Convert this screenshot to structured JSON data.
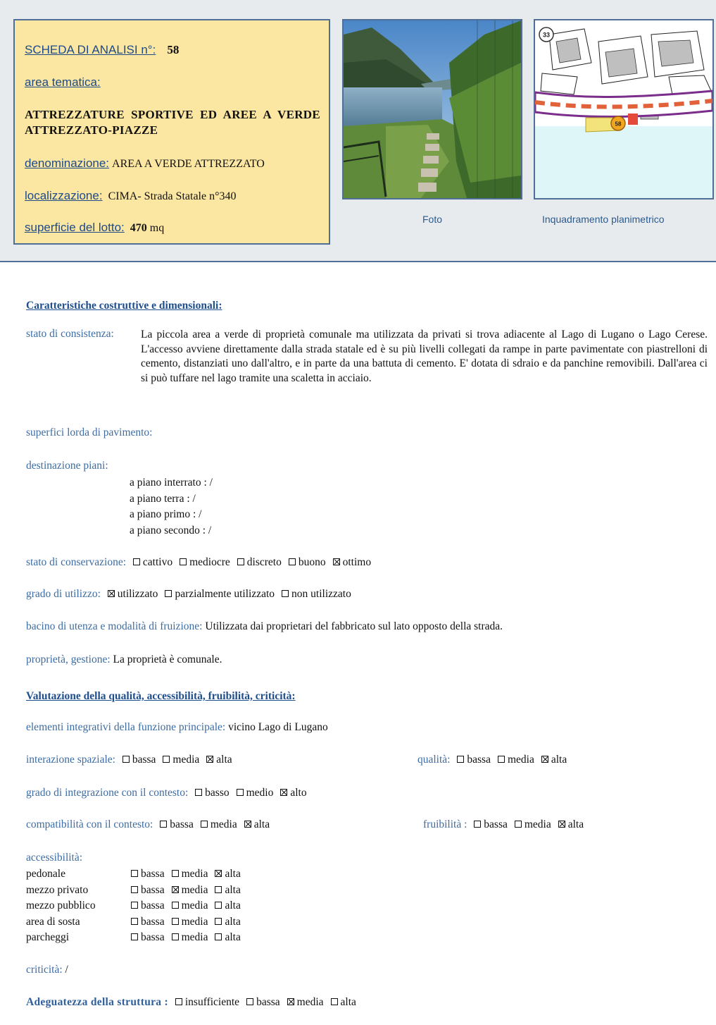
{
  "header": {
    "scheda_label": "SCHEDA DI ANALISI n°:",
    "scheda_number": "58",
    "area_label": "area tematica:",
    "area_value": "ATTREZZATURE SPORTIVE ED AREE A VERDE ATTREZZATO-PIAZZE",
    "denominazione_label": "denominazione:",
    "denominazione_value": "AREA A VERDE ATTREZZATO",
    "localizzazione_label": "localizzazione:",
    "localizzazione_value": "CIMA- Strada Statale n°340",
    "superficie_label": "superficie del lotto:",
    "superficie_value": "470",
    "superficie_unit": "mq",
    "photo_caption": "Foto",
    "map_caption": "Inquadramento planimetrico",
    "map_badge_top": "33",
    "map_badge_site": "58"
  },
  "body": {
    "section1_title": "Caratteristiche costruttive e dimensionali:",
    "stato_consistenza_label": "stato di consistenza:",
    "stato_consistenza_text": "La piccola area a verde di proprietà comunale ma utilizzata da privati si trova adiacente al Lago di Lugano o Lago Cerese. L'accesso avviene direttamente dalla strada statale ed è su più livelli collegati da rampe in parte pavimentate con piastrelloni di cemento, distanziati uno dall'altro, e in parte da una battuta di cemento. E' dotata di sdraio e da panchine removibili. Dall'area ci si può tuffare nel lago tramite una scaletta in acciaio.",
    "superfici_label": "superfici lorda di pavimento:",
    "destinazione_label": "destinazione piani:",
    "piani": [
      "a piano interrato : /",
      "a piano terra : /",
      "a piano primo : /",
      "a piano secondo : /"
    ],
    "conservazione_label": "stato di conservazione:",
    "conservazione_options": [
      {
        "label": "cattivo",
        "checked": false
      },
      {
        "label": "mediocre",
        "checked": false
      },
      {
        "label": "discreto",
        "checked": false
      },
      {
        "label": "buono",
        "checked": false
      },
      {
        "label": "ottimo",
        "checked": true
      }
    ],
    "utilizzo_label": "grado di utilizzo:",
    "utilizzo_options": [
      {
        "label": "utilizzato",
        "checked": true
      },
      {
        "label": "parzialmente utilizzato",
        "checked": false
      },
      {
        "label": "non utilizzato",
        "checked": false
      }
    ],
    "bacino_label": "bacino di utenza e modalità di fruizione:",
    "bacino_value": "Utilizzata dai proprietari del fabbricato sul lato opposto della strada.",
    "proprieta_label": "proprietà, gestione:",
    "proprieta_value": "La proprietà è comunale.",
    "section2_title": "Valutazione della qualità, accessibilità, fruibilità, criticità:",
    "elementi_label": "elementi integrativi della funzione principale:",
    "elementi_value": "vicino Lago di Lugano",
    "interazione_label": "interazione spaziale:",
    "interazione_options": [
      {
        "label": "bassa",
        "checked": false
      },
      {
        "label": "media",
        "checked": false
      },
      {
        "label": "alta",
        "checked": true
      }
    ],
    "qualita_label": "qualità:",
    "qualita_options": [
      {
        "label": "bassa",
        "checked": false
      },
      {
        "label": "media",
        "checked": false
      },
      {
        "label": "alta",
        "checked": true
      }
    ],
    "integrazione_label": "grado di integrazione con il contesto:",
    "integrazione_options": [
      {
        "label": "basso",
        "checked": false
      },
      {
        "label": "medio",
        "checked": false
      },
      {
        "label": "alto",
        "checked": true
      }
    ],
    "compatibilita_label": "compatibilità con il contesto:",
    "compatibilita_options": [
      {
        "label": "bassa",
        "checked": false
      },
      {
        "label": "media",
        "checked": false
      },
      {
        "label": "alta",
        "checked": true
      }
    ],
    "fruibilita_label": "fruibilità :",
    "fruibilita_options": [
      {
        "label": "bassa",
        "checked": false
      },
      {
        "label": "media",
        "checked": false
      },
      {
        "label": "alta",
        "checked": true
      }
    ],
    "accessibilita_label": "accessibilità:",
    "accessibilita_rows": [
      {
        "name": "pedonale",
        "options": [
          {
            "label": "bassa",
            "checked": false
          },
          {
            "label": "media",
            "checked": false
          },
          {
            "label": "alta",
            "checked": true
          }
        ]
      },
      {
        "name": "mezzo privato",
        "options": [
          {
            "label": "bassa",
            "checked": false
          },
          {
            "label": "media",
            "checked": true
          },
          {
            "label": "alta",
            "checked": false
          }
        ]
      },
      {
        "name": "mezzo pubblico",
        "options": [
          {
            "label": "bassa",
            "checked": false
          },
          {
            "label": "media",
            "checked": false
          },
          {
            "label": "alta",
            "checked": false
          }
        ]
      },
      {
        "name": "area di sosta",
        "options": [
          {
            "label": "bassa",
            "checked": false
          },
          {
            "label": "media",
            "checked": false
          },
          {
            "label": "alta",
            "checked": false
          }
        ]
      },
      {
        "name": "parcheggi",
        "options": [
          {
            "label": "bassa",
            "checked": false
          },
          {
            "label": "media",
            "checked": false
          },
          {
            "label": "alta",
            "checked": false
          }
        ]
      }
    ],
    "criticita_label": "criticità:",
    "criticita_value": "/",
    "adeguatezza_label": "Adeguatezza della struttura :",
    "adeguatezza_options": [
      {
        "label": "insufficiente",
        "checked": false
      },
      {
        "label": "bassa",
        "checked": false
      },
      {
        "label": "media",
        "checked": true
      },
      {
        "label": "alta",
        "checked": false
      }
    ]
  },
  "colors": {
    "info_box_bg": "#fbe6a2",
    "header_bg": "#e8ebee",
    "label_blue": "#3c6ca3",
    "frame_border": "#4f6f96"
  }
}
